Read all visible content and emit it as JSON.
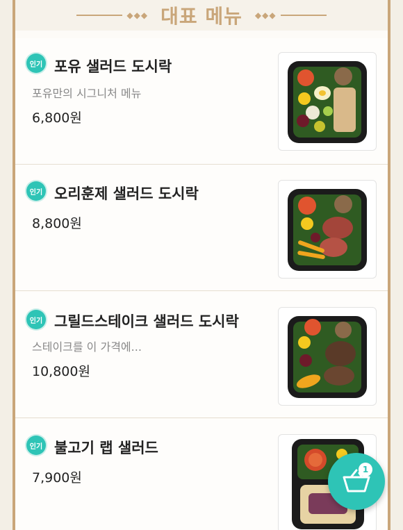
{
  "section": {
    "title": "대표 메뉴"
  },
  "colors": {
    "accent_gold": "#c9a67a",
    "badge_teal": "#2ec4b6",
    "price_text": "#222222",
    "desc_text": "#888888"
  },
  "menu_items": [
    {
      "badge": "인기",
      "name": "포유 샐러드 도시락",
      "description": "포유만의 시그니처 메뉴",
      "price": "6,800원"
    },
    {
      "badge": "인기",
      "name": "오리훈제 샐러드 도시락",
      "description": "",
      "price": "8,800원"
    },
    {
      "badge": "인기",
      "name": "그릴드스테이크 샐러드 도시락",
      "description": "스테이크를 이 가격에...",
      "price": "10,800원"
    },
    {
      "badge": "인기",
      "name": "불고기 랩 샐러드",
      "description": "",
      "price": "7,900원"
    }
  ],
  "cart": {
    "count": "1",
    "icon": "shopping-basket-icon"
  }
}
